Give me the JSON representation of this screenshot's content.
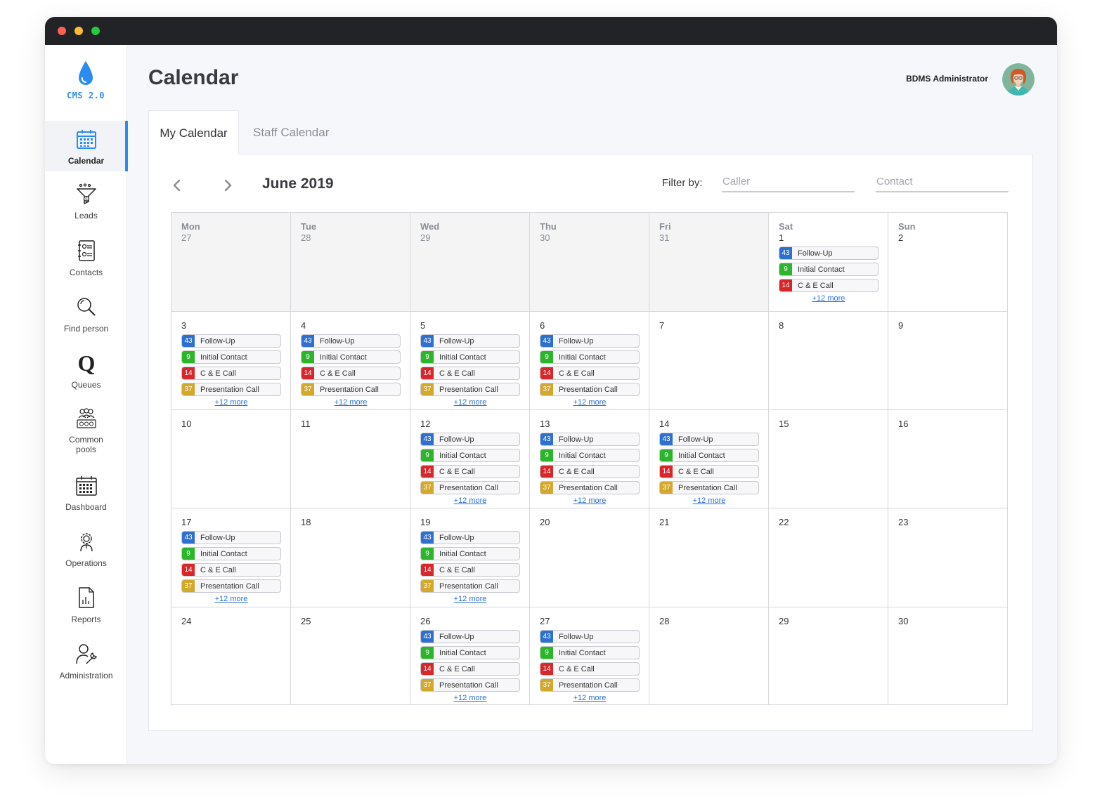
{
  "app": {
    "logo_text": "CMS 2.0"
  },
  "sidebar": {
    "items": [
      {
        "label": "Calendar",
        "icon": "calendar-icon",
        "active": true
      },
      {
        "label": "Leads",
        "icon": "funnel-icon"
      },
      {
        "label": "Contacts",
        "icon": "contacts-book-icon"
      },
      {
        "label": "Find person",
        "icon": "magnifier-icon"
      },
      {
        "label": "Queues",
        "icon": "queue-q-icon"
      },
      {
        "label": "Common pools",
        "icon": "group-pool-icon"
      },
      {
        "label": "Dashboard",
        "icon": "dashboard-calendar-icon"
      },
      {
        "label": "Operations",
        "icon": "gear-person-icon"
      },
      {
        "label": "Reports",
        "icon": "report-document-icon"
      },
      {
        "label": "Administration",
        "icon": "admin-wrench-icon"
      }
    ]
  },
  "header": {
    "title": "Calendar",
    "user_name": "BDMS Administrator"
  },
  "tabs": [
    {
      "label": "My Calendar",
      "active": true
    },
    {
      "label": "Staff Calendar",
      "active": false
    }
  ],
  "calendar": {
    "month_label": "June 2019",
    "filter_label": "Filter by:",
    "caller_placeholder": "Caller",
    "contact_placeholder": "Contact",
    "weekdays": [
      "Mon",
      "Tue",
      "Wed",
      "Thu",
      "Fri",
      "Sat",
      "Sun"
    ],
    "event_types": [
      {
        "count": "43",
        "label": "Follow-Up",
        "color": "#2f6fd0"
      },
      {
        "count": "9",
        "label": "Initial Contact",
        "color": "#2bb52b"
      },
      {
        "count": "14",
        "label": "C & E Call",
        "color": "#d9262b"
      },
      {
        "count": "37",
        "label": "Presentation Call",
        "color": "#d4a82a"
      }
    ],
    "more_label": "+12 more",
    "days": [
      {
        "day": "27",
        "prev": true,
        "events": []
      },
      {
        "day": "28",
        "prev": true,
        "events": []
      },
      {
        "day": "29",
        "prev": true,
        "events": []
      },
      {
        "day": "30",
        "prev": true,
        "events": []
      },
      {
        "day": "31",
        "prev": true,
        "events": []
      },
      {
        "day": "1",
        "events": [
          0,
          1,
          2
        ],
        "more": true
      },
      {
        "day": "2",
        "events": []
      },
      {
        "day": "3",
        "events": [
          0,
          1,
          2,
          3
        ],
        "more": true
      },
      {
        "day": "4",
        "events": [
          0,
          1,
          2,
          3
        ],
        "more": true
      },
      {
        "day": "5",
        "events": [
          0,
          1,
          2,
          3
        ],
        "more": true
      },
      {
        "day": "6",
        "events": [
          0,
          1,
          2,
          3
        ],
        "more": true
      },
      {
        "day": "7",
        "events": []
      },
      {
        "day": "8",
        "events": []
      },
      {
        "day": "9",
        "events": []
      },
      {
        "day": "10",
        "events": []
      },
      {
        "day": "11",
        "events": []
      },
      {
        "day": "12",
        "events": [
          0,
          1,
          2,
          3
        ],
        "more": true
      },
      {
        "day": "13",
        "events": [
          0,
          1,
          2,
          3
        ],
        "more": true
      },
      {
        "day": "14",
        "events": [
          0,
          1,
          2,
          3
        ],
        "more": true
      },
      {
        "day": "15",
        "events": []
      },
      {
        "day": "16",
        "events": []
      },
      {
        "day": "17",
        "events": [
          0,
          1,
          2,
          3
        ],
        "more": true
      },
      {
        "day": "18",
        "events": []
      },
      {
        "day": "19",
        "events": [
          0,
          1,
          2,
          3
        ],
        "more": true
      },
      {
        "day": "20",
        "events": []
      },
      {
        "day": "21",
        "events": []
      },
      {
        "day": "22",
        "events": []
      },
      {
        "day": "23",
        "events": []
      },
      {
        "day": "24",
        "events": []
      },
      {
        "day": "25",
        "events": []
      },
      {
        "day": "26",
        "events": [
          0,
          1,
          2,
          3
        ],
        "more": true
      },
      {
        "day": "27",
        "events": [
          0,
          1,
          2,
          3
        ],
        "more": true
      },
      {
        "day": "28",
        "events": []
      },
      {
        "day": "29",
        "events": []
      },
      {
        "day": "30",
        "events": []
      }
    ]
  },
  "colors": {
    "accent": "#2a8cef",
    "link": "#2a6fd3"
  }
}
